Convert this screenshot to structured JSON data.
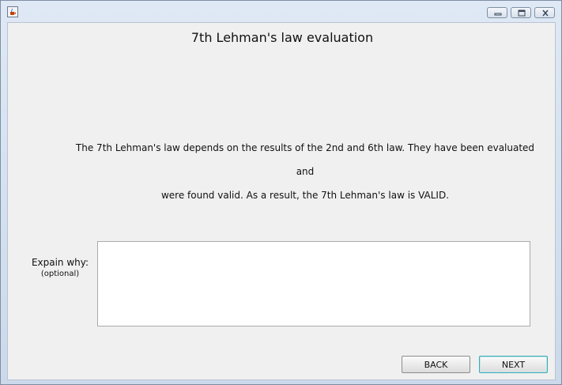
{
  "window": {
    "icon": "java-cup-icon",
    "controls": [
      "minimize-icon",
      "maximize-icon",
      "close-icon"
    ]
  },
  "main": {
    "title": "7th Lehman's law evaluation",
    "message_line1": "The 7th Lehman's law depends on the results of the 2nd and 6th law. They have been evaluated and",
    "message_line2": "were found valid. As a result, the 7th Lehman's law is VALID.",
    "explain_label": "Expain why:",
    "optional_label": "(optional)",
    "explain_value": ""
  },
  "buttons": {
    "back_label": "BACK",
    "next_label": "NEXT"
  },
  "colors": {
    "window_frame": "#cbd9ea",
    "content_bg": "#f0f0f0",
    "focus_border": "#3aa9b4"
  }
}
